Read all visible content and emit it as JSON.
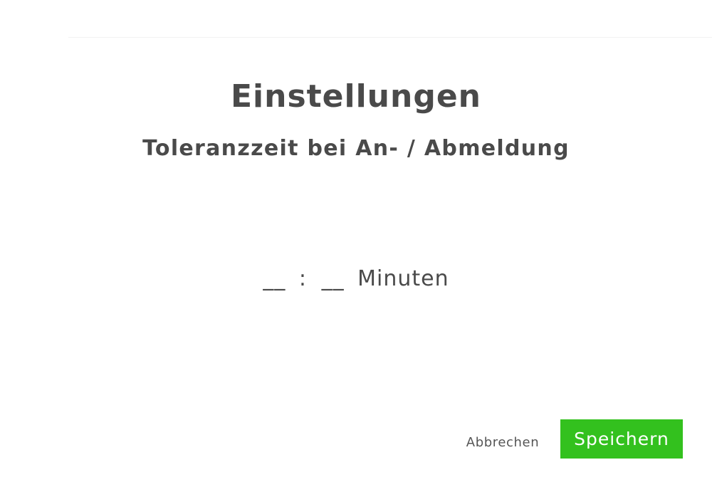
{
  "dialog": {
    "title": "Einstellungen",
    "subtitle": "Toleranzzeit bei An- / Abmeldung"
  },
  "time_input": {
    "hours_placeholder": "__",
    "separator": ":",
    "minutes_placeholder": "__",
    "unit": "Minuten"
  },
  "actions": {
    "cancel_label": "Abbrechen",
    "save_label": "Speichern"
  },
  "colors": {
    "accent": "#33c11e",
    "text": "#4a4a4a"
  }
}
